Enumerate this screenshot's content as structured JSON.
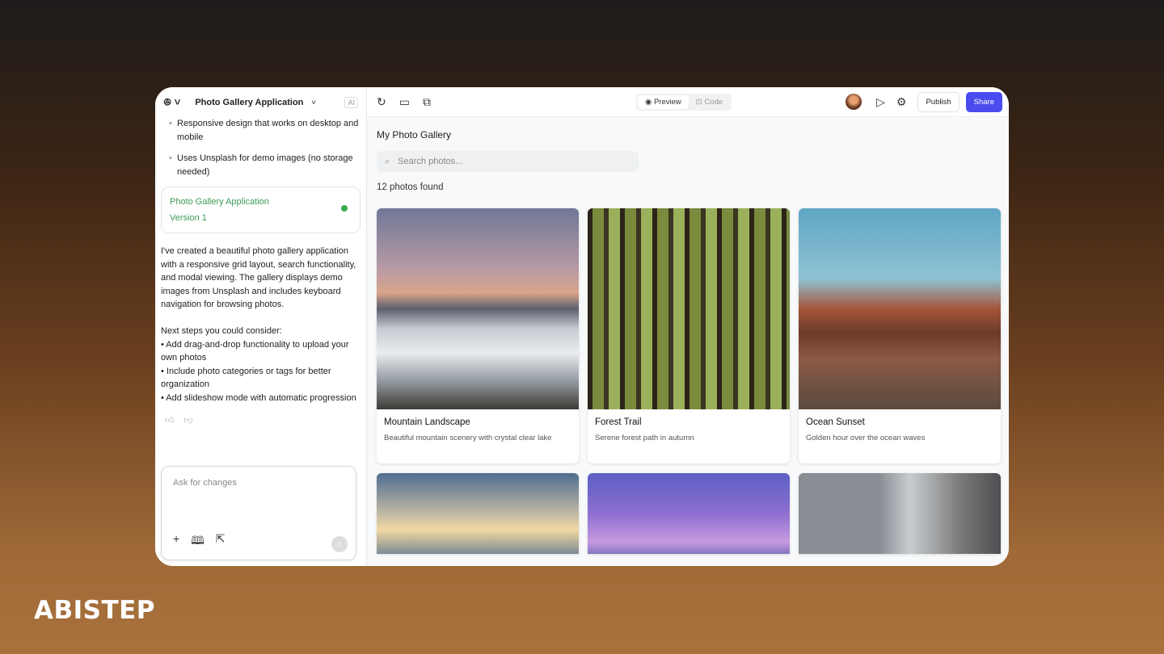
{
  "sidebar": {
    "project": "Photo Gallery Application",
    "ai_badge": "AI",
    "bullets": [
      "Responsive design that works on desktop and mobile",
      "Uses Unsplash for demo images (no storage needed)"
    ],
    "version": {
      "title": "Photo Gallery Application",
      "label": "Version 1"
    },
    "message": [
      "I've created a beautiful photo gallery application with a responsive grid layout, search functionality, and modal viewing. The gallery displays demo images from Unsplash and includes keyboard navigation for browsing photos.",
      "Next steps you could consider:",
      "• Add drag-and-drop functionality to upload your own photos",
      "• Include photo categories or tags for better organization",
      "• Add slideshow mode with automatic progression"
    ],
    "chat_placeholder": "Ask for changes"
  },
  "toolbar": {
    "preview": "Preview",
    "code": "Code",
    "publish": "Publish",
    "share": "Share"
  },
  "gallery": {
    "title": "My Photo Gallery",
    "search_placeholder": "Search photos...",
    "count": "12 photos found",
    "photos": [
      {
        "title": "Mountain Landscape",
        "desc": "Beautiful mountain scenery with crystal clear lake"
      },
      {
        "title": "Forest Trail",
        "desc": "Serene forest path in autumn"
      },
      {
        "title": "Ocean Sunset",
        "desc": "Golden hour over the ocean waves"
      }
    ]
  },
  "brand": "ABISTEP"
}
